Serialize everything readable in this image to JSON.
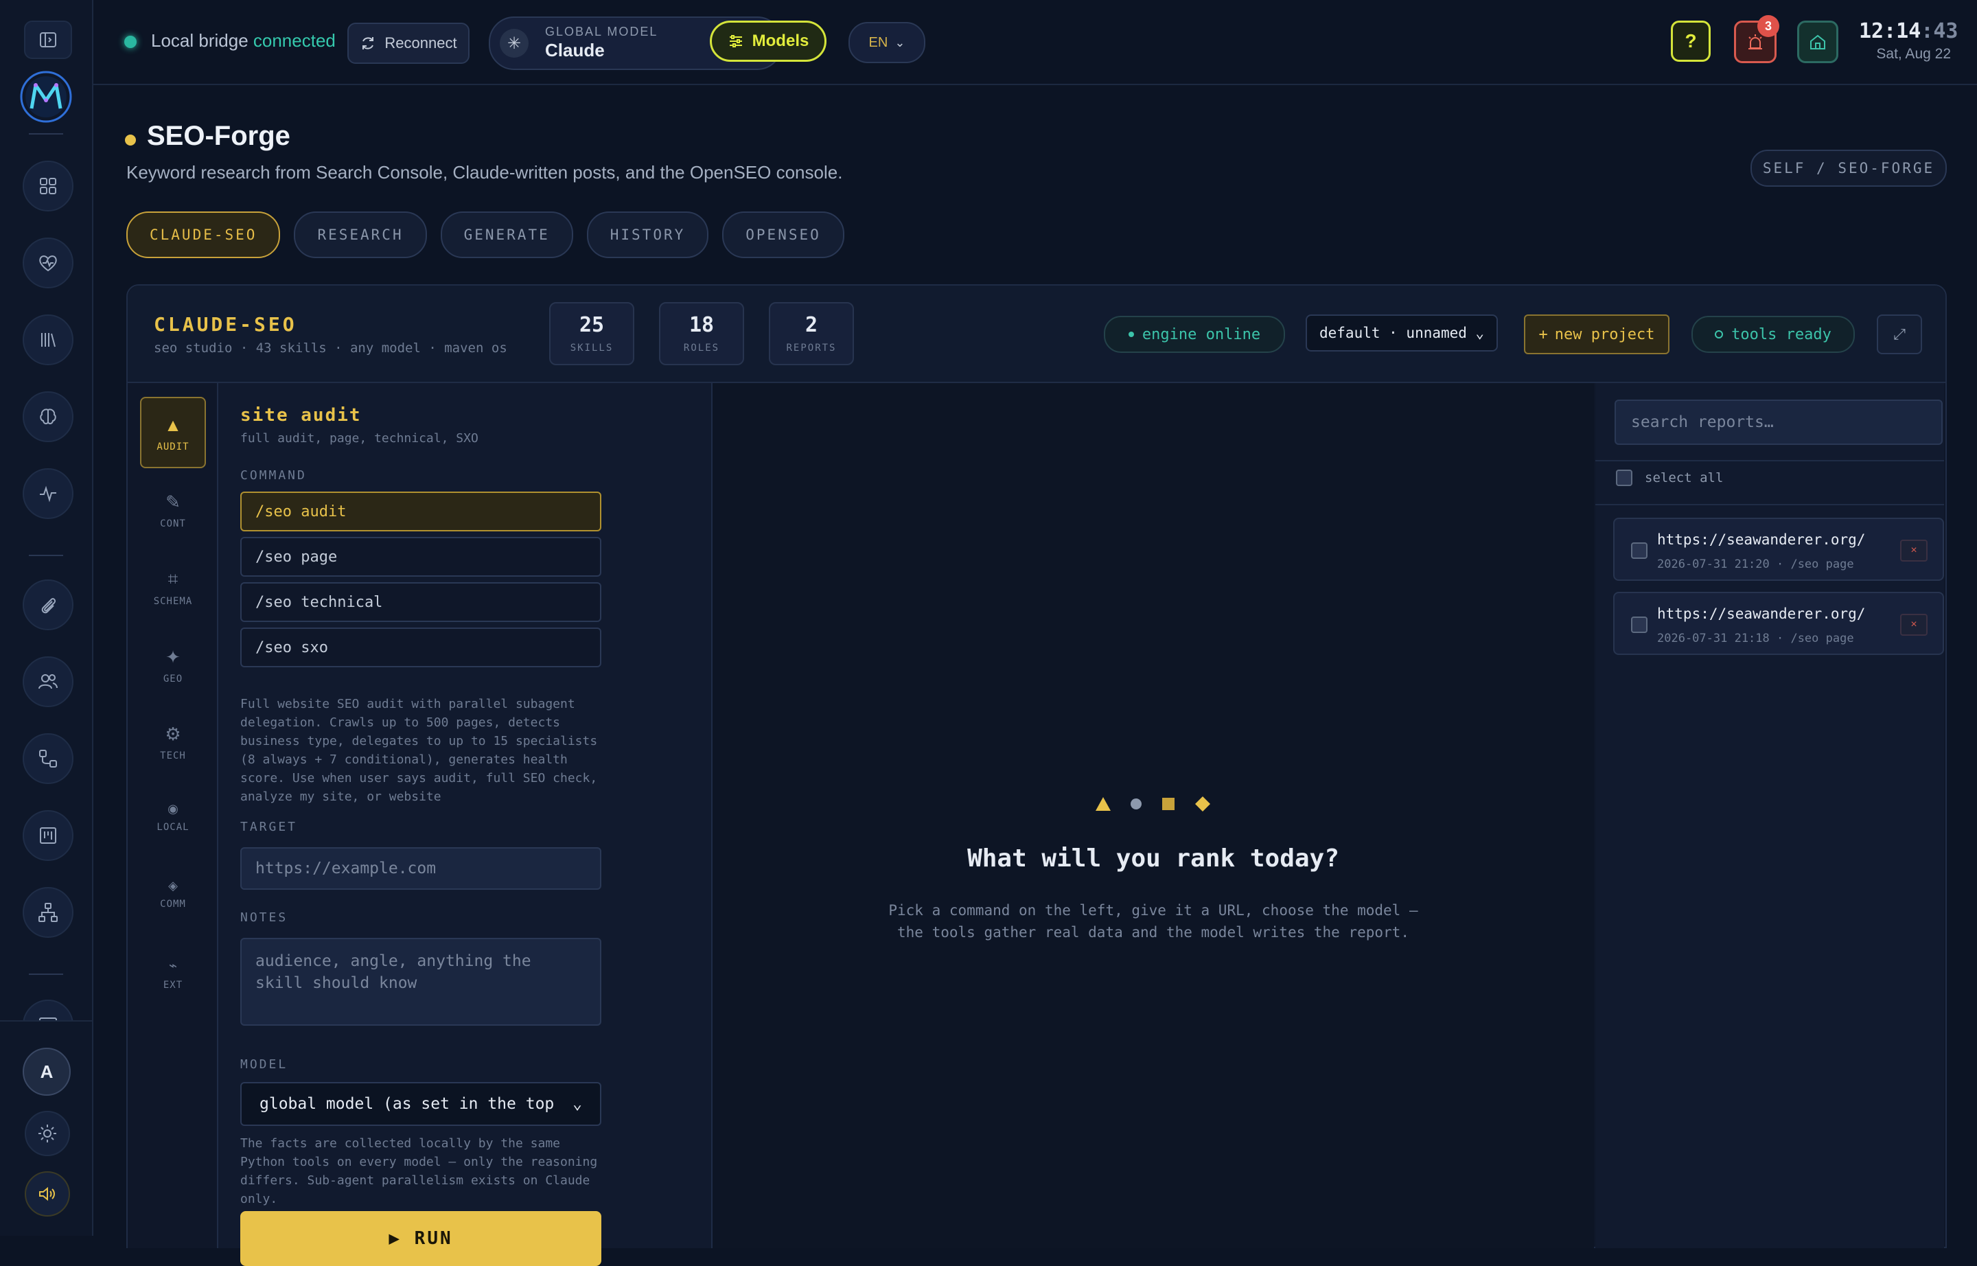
{
  "topbar": {
    "bridge_prefix": "Local bridge",
    "bridge_status": "connected",
    "reconnect_label": "Reconnect",
    "global_model_label": "GLOBAL MODEL",
    "global_model_value": "Claude",
    "models_label": "Models",
    "language": "EN",
    "help_label": "?",
    "alert_count": "3",
    "clock_hm": "12:14",
    "clock_sec": ":43",
    "clock_date": "Sat, Aug 22"
  },
  "page": {
    "title": "SEO-Forge",
    "subtitle": "Keyword research from Search Console, Claude-written posts, and the OpenSEO console.",
    "path": "SELF / SEO-FORGE",
    "tabs": [
      {
        "label": "CLAUDE-SEO"
      },
      {
        "label": "RESEARCH"
      },
      {
        "label": "GENERATE"
      },
      {
        "label": "HISTORY"
      },
      {
        "label": "OPENSEO"
      }
    ]
  },
  "panel": {
    "title": "CLAUDE-SEO",
    "subtitle": "seo studio · 43 skills · any model · maven os",
    "stats": [
      {
        "value": "25",
        "label": "SKILLS"
      },
      {
        "value": "18",
        "label": "ROLES"
      },
      {
        "value": "2",
        "label": "REPORTS"
      }
    ],
    "engine_status": "engine online",
    "project_select": "default · unnamed",
    "new_project_label": "new project",
    "tools_status": "tools ready"
  },
  "skills_nav": [
    {
      "icon": "▲",
      "label": "AUDIT"
    },
    {
      "icon": "✎",
      "label": "CONT"
    },
    {
      "icon": "⌗",
      "label": "SCHEMA"
    },
    {
      "icon": "✦",
      "label": "GEO"
    },
    {
      "icon": "⚙",
      "label": "TECH"
    },
    {
      "icon": "◉",
      "label": "LOCAL"
    },
    {
      "icon": "◈",
      "label": "COMM"
    },
    {
      "icon": "⌁",
      "label": "EXT"
    }
  ],
  "form": {
    "title": "site audit",
    "subtitle": "full audit, page, technical, SXO",
    "command_label": "COMMAND",
    "commands": [
      "/seo audit",
      "/seo page",
      "/seo technical",
      "/seo sxo"
    ],
    "description": "Full website SEO audit with parallel subagent delegation. Crawls up to 500 pages, detects business type, delegates to up to 15 specialists (8 always + 7 conditional), generates health score. Use when user says audit, full SEO check, analyze my site, or website",
    "target_label": "TARGET",
    "target_placeholder": "https://example.com",
    "notes_label": "NOTES",
    "notes_placeholder": "audience, angle, anything the skill should know",
    "model_label": "MODEL",
    "model_value": "global model (as set in the top",
    "footnote": "The facts are collected locally by the same Python tools on every model — only the reasoning differs. Sub-agent parallelism exists on Claude only.",
    "run_label": "▶ RUN"
  },
  "center": {
    "title": "What will you rank today?",
    "subtitle": "Pick a command on the left, give it a URL, choose the model — the tools gather real data and the model writes the report."
  },
  "reports": {
    "search_placeholder": "search reports…",
    "select_all_label": "select all",
    "items": [
      {
        "url": "https://seawanderer.org/",
        "meta": "2026-07-31 21:20 · /seo page"
      },
      {
        "url": "https://seawanderer.org/",
        "meta": "2026-07-31 21:18 · /seo page"
      }
    ],
    "delete_label": "×"
  },
  "colors": {
    "accent_gold": "#e8c24a",
    "accent_lime": "#e1ec3c",
    "status_teal": "#3cc4aa",
    "alert_red": "#e0524a",
    "background": "#0c1424"
  }
}
